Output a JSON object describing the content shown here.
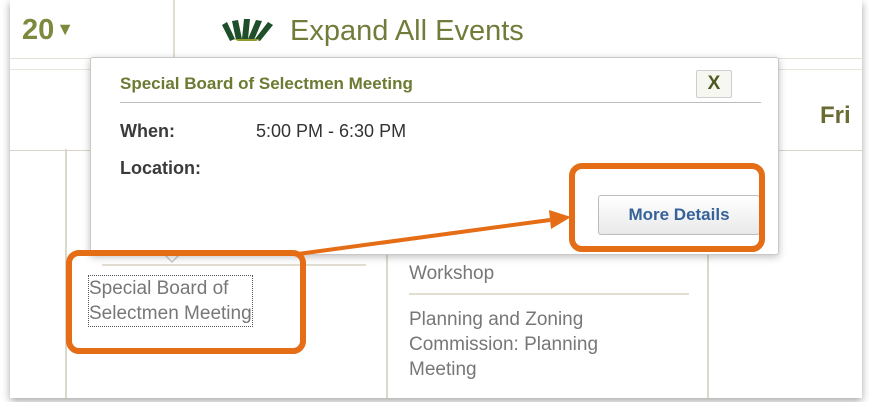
{
  "toolbar": {
    "year_text": "20",
    "year_arrow": "▼",
    "expand_label": "Expand All Events",
    "expand_icon": "starburst-icon"
  },
  "calendar": {
    "day_header": "Fri",
    "events": [
      {
        "line1": "Special Board of",
        "line2": "Selectmen Meeting"
      },
      {
        "text": "Workshop"
      },
      {
        "line1": "Planning and Zoning",
        "line2": "Commission: Planning",
        "line3": "Meeting"
      }
    ]
  },
  "popup": {
    "title": "Special Board of Selectmen Meeting",
    "close": "X",
    "when_label": "When:",
    "when_value": "5:00 PM - 6:30 PM",
    "location_label": "Location:",
    "location_value": "",
    "more_details": "More Details"
  },
  "annotation": {
    "color": "#e46d16"
  }
}
